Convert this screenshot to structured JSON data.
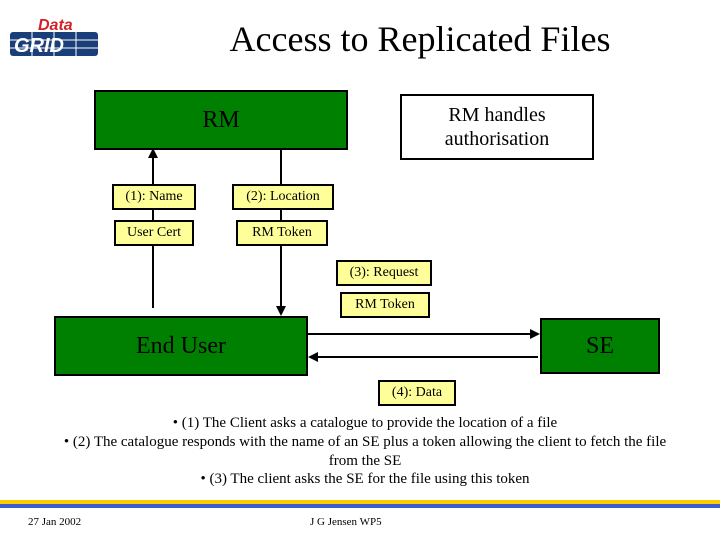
{
  "title": "Access to Replicated Files",
  "logo": {
    "top": "Data",
    "bottom": "GRID"
  },
  "nodes": {
    "rm": "RM",
    "rm_note": "RM handles authorisation",
    "end_user": "End User",
    "se": "SE"
  },
  "labels": {
    "step1": "(1): Name",
    "user_cert": "User Cert",
    "step2": "(2): Location",
    "rm_token_down": "RM Token",
    "step3": "(3): Request",
    "rm_token_right": "RM Token",
    "step4": "(4): Data"
  },
  "bullets": [
    "• (1) The Client asks a catalogue to provide the location of a file",
    "• (2) The catalogue responds with the name of an SE plus a token allowing the client to fetch the file from the SE",
    "• (3) The client asks the SE for the file using this token"
  ],
  "footer": {
    "date": "27 Jan 2002",
    "center": "J G Jensen WP5"
  },
  "colors": {
    "green": "#008000",
    "yellow": "#ffff99",
    "barYellow": "#ffcc00",
    "barBlue": "#3a5fcd",
    "logoRed": "#d2232a",
    "logoBlue": "#1a3e7a"
  }
}
